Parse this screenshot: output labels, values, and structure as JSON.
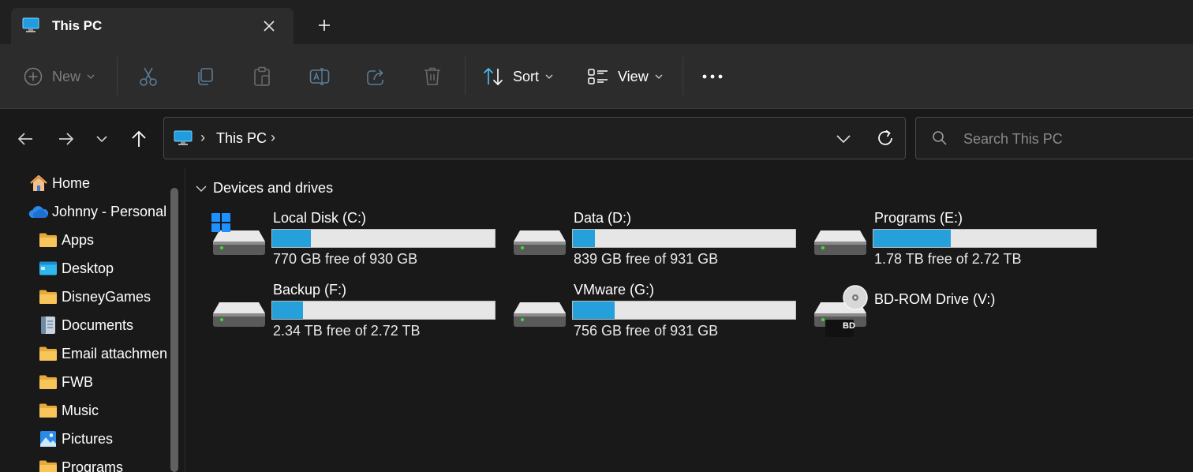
{
  "tab": {
    "title": "This PC",
    "close_glyph": "✕",
    "new_tab_glyph": "+"
  },
  "toolbar": {
    "new_label": "New",
    "sort_label": "Sort",
    "view_label": "View",
    "more_glyph": "•••"
  },
  "address": {
    "separator": "›",
    "crumb": "This PC"
  },
  "search": {
    "placeholder": "Search This PC"
  },
  "sidebar": {
    "items": [
      {
        "label": "Home",
        "icon": "home-icon"
      },
      {
        "label": "Johnny - Personal",
        "icon": "onedrive-cloud-icon"
      },
      {
        "label": "Apps",
        "icon": "folder-icon"
      },
      {
        "label": "Desktop",
        "icon": "desktop-folder-icon"
      },
      {
        "label": "DisneyGames",
        "icon": "folder-icon"
      },
      {
        "label": "Documents",
        "icon": "documents-folder-icon"
      },
      {
        "label": "Email attachmen",
        "icon": "folder-icon"
      },
      {
        "label": "FWB",
        "icon": "folder-icon"
      },
      {
        "label": "Music",
        "icon": "folder-icon"
      },
      {
        "label": "Pictures",
        "icon": "pictures-folder-icon"
      },
      {
        "label": "Programs",
        "icon": "folder-icon"
      }
    ]
  },
  "content": {
    "group_label": "Devices and drives",
    "drives": [
      {
        "name": "Local Disk (C:)",
        "free_text": "770 GB free of 930 GB",
        "used_fraction": 0.172,
        "icon": "windows-drive-icon"
      },
      {
        "name": "Data (D:)",
        "free_text": "839 GB free of 931 GB",
        "used_fraction": 0.099,
        "icon": "hard-drive-icon"
      },
      {
        "name": "Programs (E:)",
        "free_text": "1.78 TB free of 2.72 TB",
        "used_fraction": 0.346,
        "icon": "hard-drive-icon"
      },
      {
        "name": "Backup (F:)",
        "free_text": "2.34 TB free of 2.72 TB",
        "used_fraction": 0.14,
        "icon": "hard-drive-icon"
      },
      {
        "name": "VMware (G:)",
        "free_text": "756 GB free of 931 GB",
        "used_fraction": 0.188,
        "icon": "hard-drive-icon"
      }
    ],
    "bd_drive": {
      "name": "BD-ROM Drive (V:)",
      "badge": "BD",
      "icon": "bd-rom-drive-icon"
    }
  },
  "colors": {
    "accent": "#26a0da",
    "folder": "#f7c55a",
    "background": "#191919"
  }
}
